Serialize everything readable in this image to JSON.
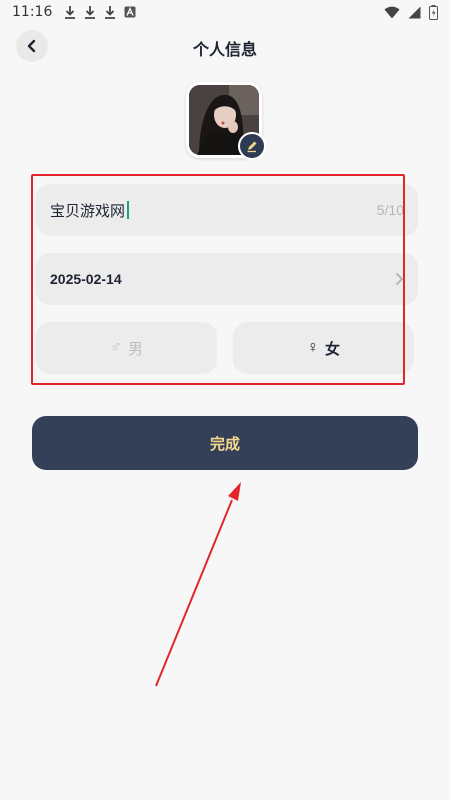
{
  "status_bar": {
    "time": "11:16"
  },
  "header": {
    "title": "个人信息"
  },
  "form": {
    "nickname": {
      "value": "宝贝游戏网",
      "counter": "5/10"
    },
    "birthday": {
      "value": "2025-02-14"
    },
    "gender": {
      "male_label": "男",
      "female_label": "女",
      "male_symbol": "♂",
      "female_symbol": "♀",
      "selected": "female"
    }
  },
  "done_button": {
    "label": "完成"
  },
  "colors": {
    "primary": "#334058",
    "button_text": "#f6d88a",
    "annotation": "#e2262b",
    "cursor": "#1e9e8a"
  }
}
